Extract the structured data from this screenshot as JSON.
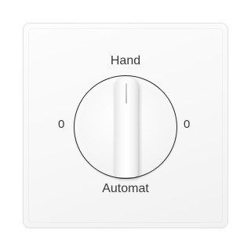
{
  "switch": {
    "label_top": "Hand",
    "label_bottom": "Automat",
    "label_left": "0",
    "label_right": "0"
  },
  "colors": {
    "plate": "#f7f7f7",
    "ring": "#2a2a2a",
    "text": "#3a3a3a"
  }
}
